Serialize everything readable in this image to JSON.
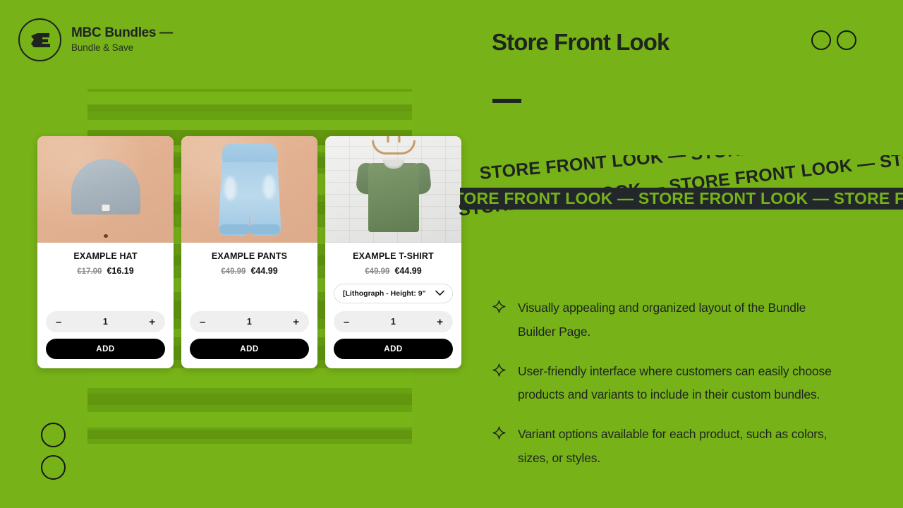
{
  "brand": {
    "logo_icon": "mbc-logo-mark",
    "title": "MBC Bundles —",
    "subtitle": "Bundle & Save"
  },
  "header": {
    "title": "Store Front Look",
    "accent_color": "#76b218",
    "text_color": "#1f2420"
  },
  "marquee": {
    "top_text": "STORE FRONT LOOK — STORE FRONT LOOK — STORE FRONT LOOK",
    "bar_text": "STORE FRONT LOOK — STORE FRONT LOOK — STORE FRONT LOOK",
    "bottom_text": "STORE FRONT LOOK — STORE FRONT LOOK — STORE FRONT LOOK",
    "bar_bg_color": "#22272a",
    "bar_text_color": "#76b218"
  },
  "products": [
    {
      "name": "EXAMPLE HAT",
      "price_old": "€17.00",
      "price_new": "€16.19",
      "has_variant": false,
      "variant_label": "",
      "quantity": "1",
      "decrement_label": "–",
      "increment_label": "+",
      "add_label": "ADD",
      "image_alt": "grey beanie hat on kraft paper background"
    },
    {
      "name": "EXAMPLE PANTS",
      "price_old": "€49.99",
      "price_new": "€44.99",
      "has_variant": false,
      "variant_label": "",
      "quantity": "1",
      "decrement_label": "–",
      "increment_label": "+",
      "add_label": "ADD",
      "image_alt": "light blue denim jeans on kraft paper background"
    },
    {
      "name": "EXAMPLE T-SHIRT",
      "price_old": "€49.99",
      "price_new": "€44.99",
      "has_variant": true,
      "variant_label": "[Lithograph - Height: 9\"",
      "quantity": "1",
      "decrement_label": "–",
      "increment_label": "+",
      "add_label": "ADD",
      "image_alt": "green t-shirt on wooden hanger against white brick wall"
    }
  ],
  "bullets": [
    "Visually appealing and organized layout of the Bundle Builder Page.",
    "User-friendly interface where customers can easily choose products and variants to include in their custom bundles.",
    "Variant options available for each product, such as colors, sizes, or styles."
  ]
}
